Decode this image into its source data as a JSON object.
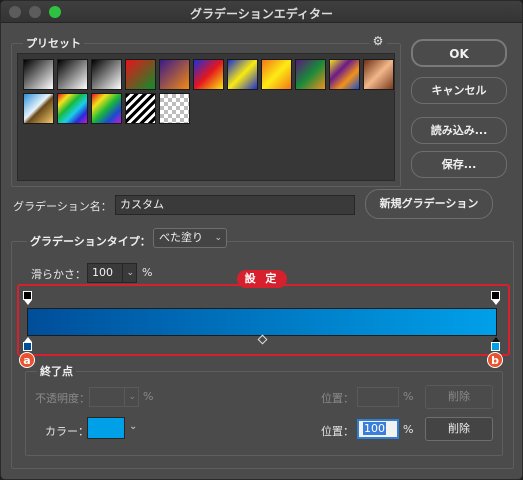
{
  "window": {
    "title": "グラデーションエディター"
  },
  "presets": {
    "label": "プリセット",
    "gear_icon": "gear-icon",
    "swatches": [
      {
        "name": "foreground-to-background",
        "style": "linear-gradient(135deg,#000 0%,#fff 100%)"
      },
      {
        "name": "foreground-to-transparent",
        "style": "linear-gradient(135deg,#000 0%,rgba(0,0,0,0) 100%)"
      },
      {
        "name": "black-white",
        "style": "linear-gradient(135deg,#000 0%,#fff 100%)"
      },
      {
        "name": "red-green",
        "style": "linear-gradient(135deg,#e8131a 0%,#0e8f2a 100%)"
      },
      {
        "name": "violet-orange",
        "style": "linear-gradient(135deg,#3a1a8a 0%,#f38a11 100%)"
      },
      {
        "name": "blue-red-yellow",
        "style": "linear-gradient(135deg,#1c2fd8 0%,#e4161f 50%,#fbe80f 100%)"
      },
      {
        "name": "blue-yellow-blue",
        "style": "linear-gradient(135deg,#1b2fcf 0%,#f9ea12 50%,#1b2fcf 100%)"
      },
      {
        "name": "orange-yellow-orange",
        "style": "linear-gradient(135deg,#f2761a 0%,#fdeb15 50%,#f2761a 100%)"
      },
      {
        "name": "violet-green-orange",
        "style": "linear-gradient(135deg,#5a1a7a 0%,#1a8a3a 50%,#f2911a 100%)"
      },
      {
        "name": "yellow-violet-orange-blue",
        "style": "linear-gradient(135deg,#f2e21a 0%,#6a1a8a 35%,#f2911a 65%,#1a4ad0 100%)"
      },
      {
        "name": "copper",
        "style": "linear-gradient(135deg,#6e2e14 0%,#f1b78a 50%,#7a3a1e 100%)"
      },
      {
        "name": "chrome",
        "style": "linear-gradient(135deg,#2a8fd8 0%,#e9f3fb 45%,#6a4a1a 55%,#f5c96a 100%)"
      },
      {
        "name": "spectrum",
        "style": "linear-gradient(135deg,#e4161f 0%,#f2e21a 20%,#1ab83a 40%,#1acfe8 60%,#2a2ad8 80%,#c41ad8 100%)"
      },
      {
        "name": "transparent-rainbow",
        "style": "linear-gradient(135deg,#e4161f 0%,#f2e21a 25%,#1ab83a 50%,#1a4ad0 75%,#c41ad8 100%)"
      },
      {
        "name": "transparent-stripes",
        "style": "repeating-linear-gradient(135deg,#000 0px,#000 3px,#fff 3px,#fff 6px)"
      },
      {
        "name": "transparent",
        "style": "checker"
      }
    ]
  },
  "buttons": {
    "ok": "OK",
    "cancel": "キャンセル",
    "load": "読み込み...",
    "save": "保存...",
    "new_gradient": "新規グラデーション"
  },
  "gradient_name": {
    "label": "グラデーション名：",
    "value": "カスタム"
  },
  "gradient_type": {
    "label": "グラデーションタイプ：",
    "value": "べた塗り"
  },
  "smoothness": {
    "label": "滑らかさ：",
    "value": "100",
    "unit": "%"
  },
  "annotation": {
    "label": "設 定",
    "marker_a": "a",
    "marker_b": "b",
    "color": "#d6202d"
  },
  "gradient": {
    "start_color": "#004e9a",
    "end_color": "#00a0e9"
  },
  "stops": {
    "label": "終了点",
    "opacity_label": "不透明度：",
    "opacity_unit": "%",
    "opacity_location_label": "位置：",
    "opacity_location_unit": "%",
    "opacity_delete": "削除",
    "color_label": "カラー：",
    "color_value": "#00a0e9",
    "color_location_label": "位置：",
    "color_location_value": "100",
    "color_location_unit": "%",
    "color_delete": "削除"
  }
}
